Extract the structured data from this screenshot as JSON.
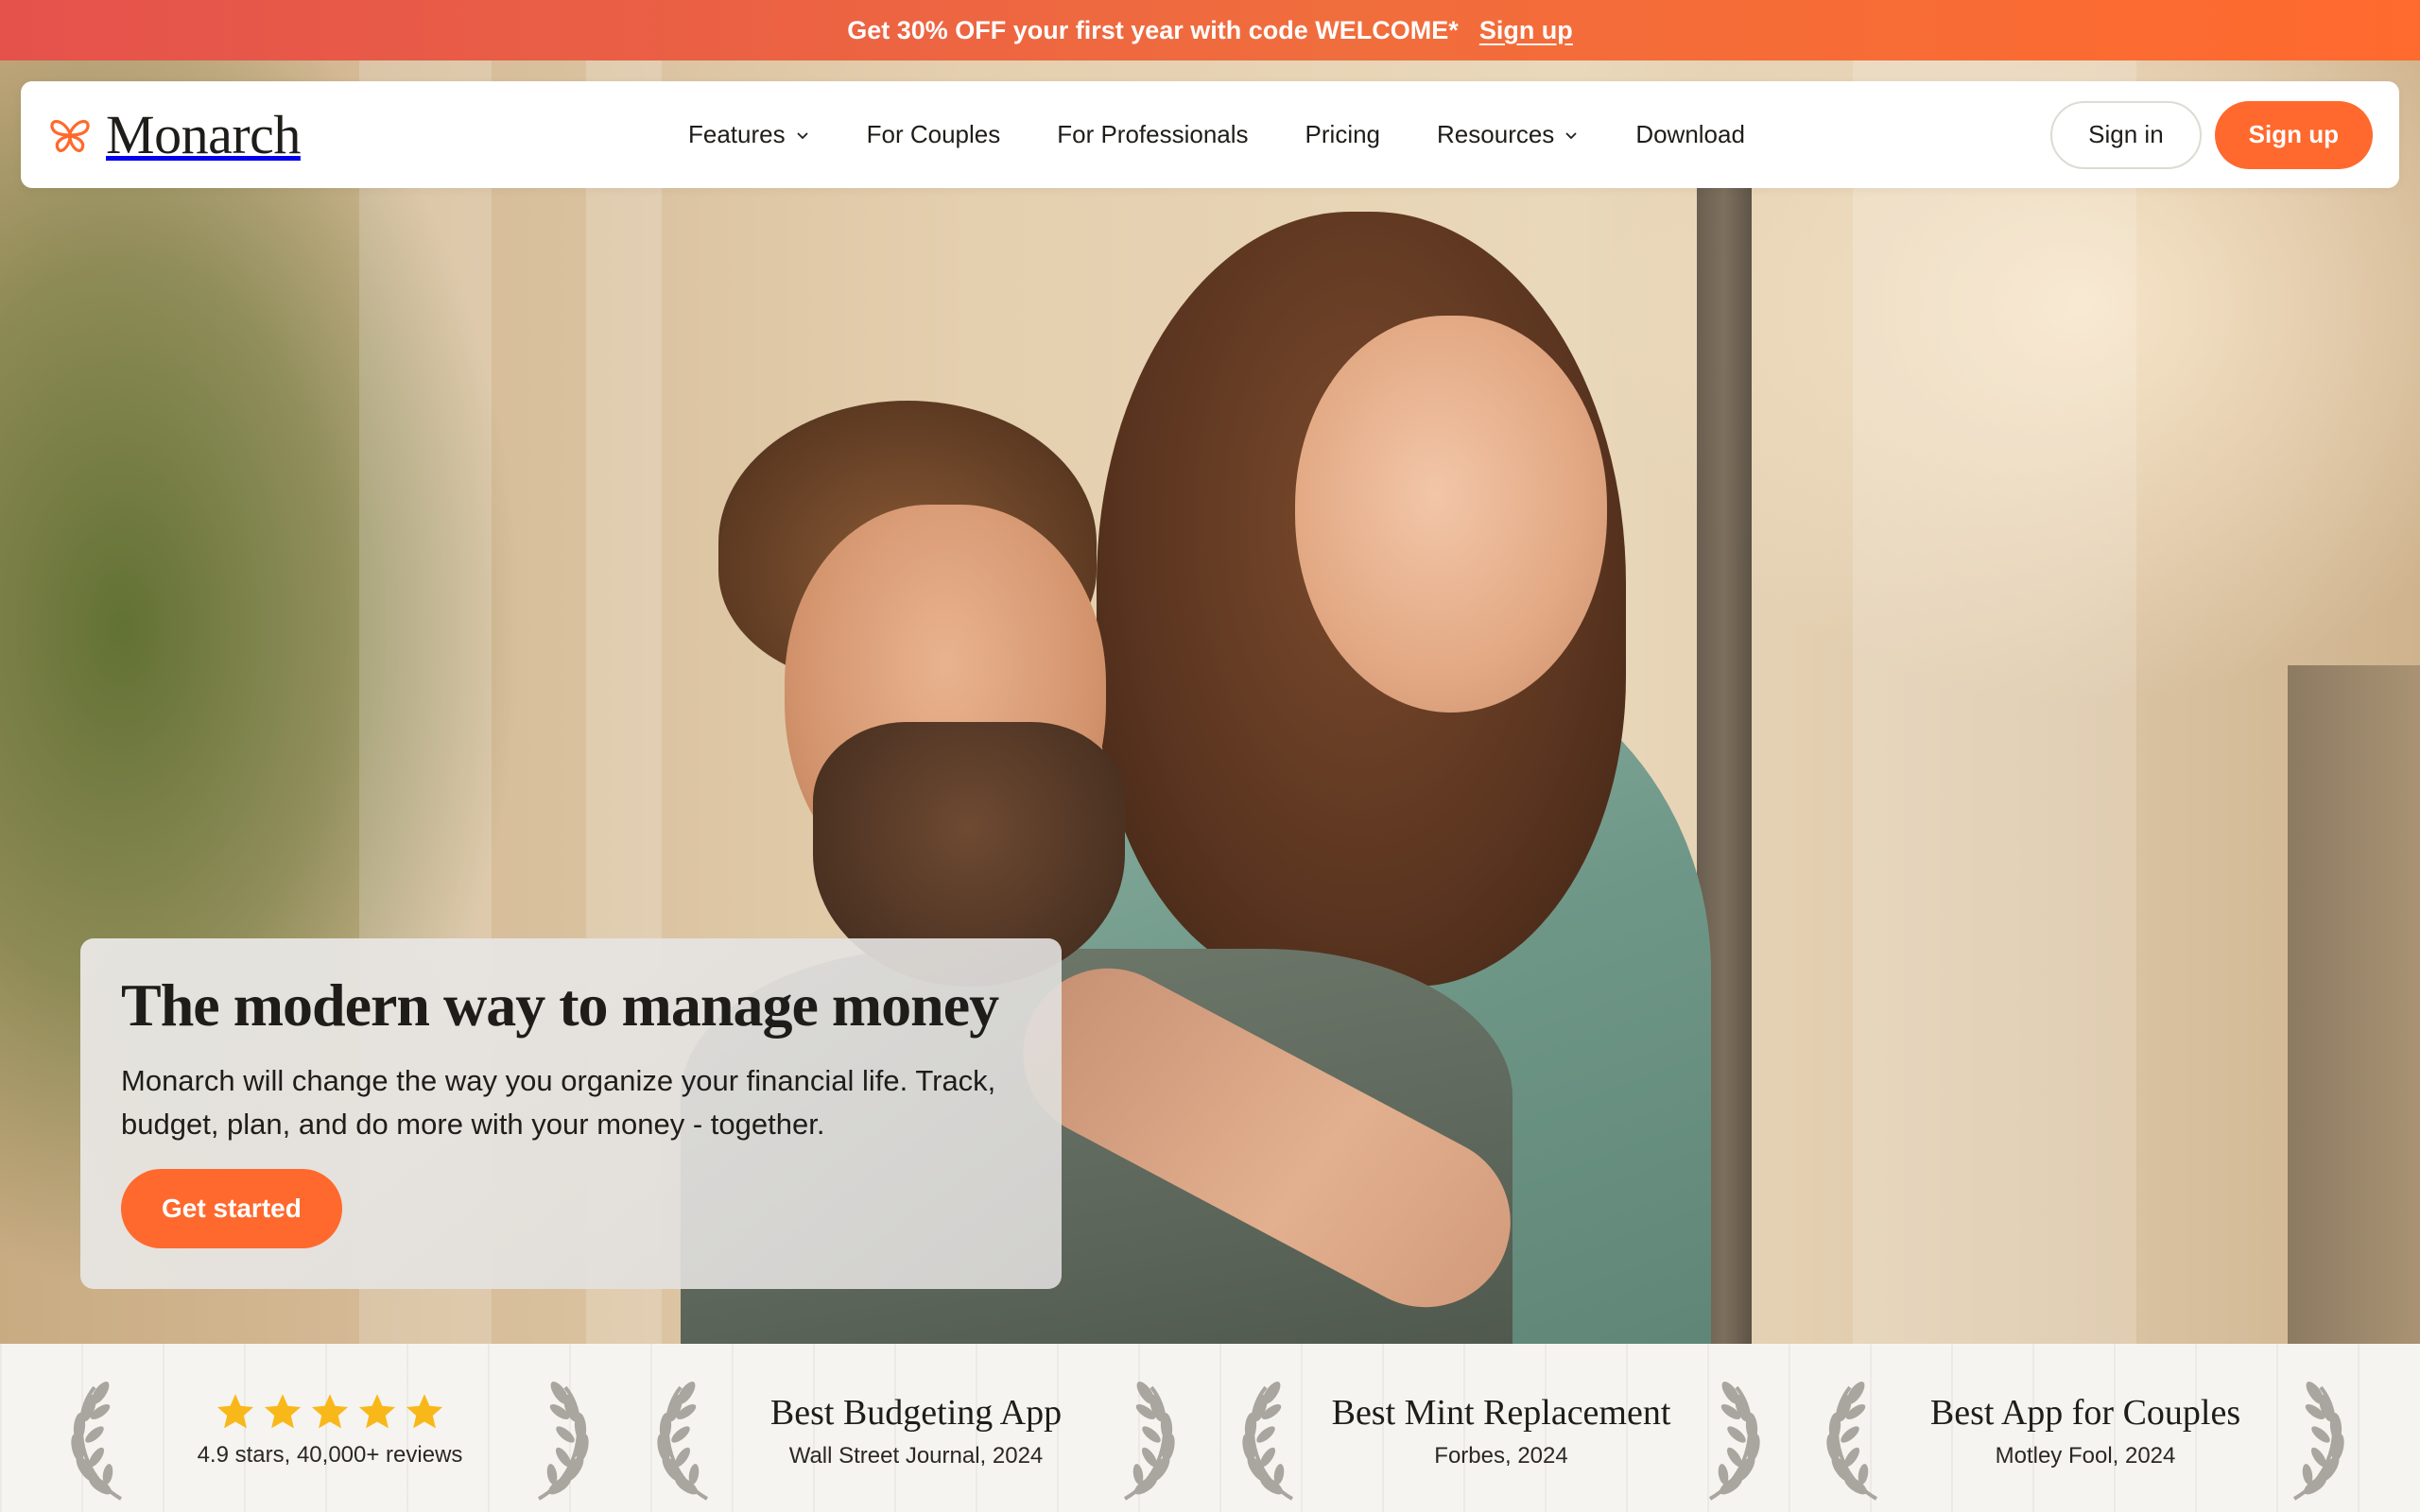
{
  "promo": {
    "text": "Get 30% OFF your first year with code WELCOME*",
    "link": "Sign up"
  },
  "nav": {
    "brand": "Monarch",
    "items": [
      {
        "label": "Features",
        "has_dropdown": true
      },
      {
        "label": "For Couples",
        "has_dropdown": false
      },
      {
        "label": "For Professionals",
        "has_dropdown": false
      },
      {
        "label": "Pricing",
        "has_dropdown": false
      },
      {
        "label": "Resources",
        "has_dropdown": true
      },
      {
        "label": "Download",
        "has_dropdown": false
      }
    ],
    "sign_in": "Sign in",
    "sign_up": "Sign up"
  },
  "hero": {
    "title": "The modern way to manage money",
    "subtitle": "Monarch will change the way you organize your financial life. Track, budget, plan, and do more with your money - together.",
    "cta": "Get started"
  },
  "awards": [
    {
      "type": "rating",
      "stars": 5,
      "caption": "4.9 stars, 40,000+ reviews"
    },
    {
      "type": "award",
      "title": "Best Budgeting App",
      "source": "Wall Street Journal, 2024"
    },
    {
      "type": "award",
      "title": "Best Mint Replacement",
      "source": "Forbes, 2024"
    },
    {
      "type": "award",
      "title": "Best App for Couples",
      "source": "Motley Fool, 2024"
    }
  ],
  "colors": {
    "accent": "#ff692d",
    "promo_start": "#e5524c",
    "promo_end": "#ff6a2e",
    "star": "#f9b81a",
    "laurel": "#a9a59f"
  },
  "icons": {
    "brand": "butterfly-icon",
    "dropdown": "chevron-down-icon",
    "rating": "star-icon",
    "award": "laurel-icon"
  }
}
